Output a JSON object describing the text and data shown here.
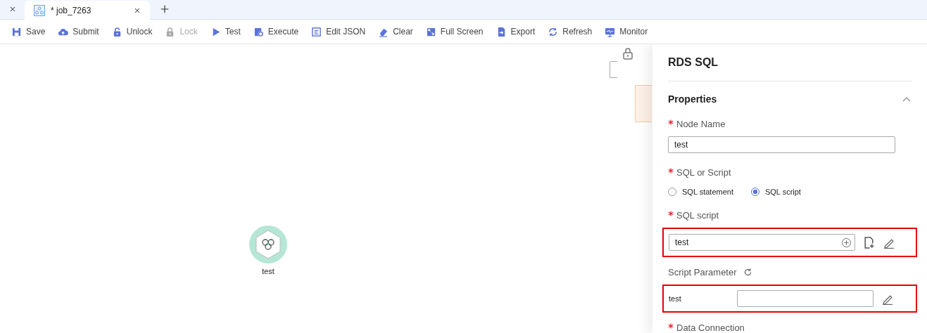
{
  "tabs": [
    {
      "label": "* job_7263",
      "selected": true
    }
  ],
  "toolbar": [
    {
      "kind": "save",
      "label": "Save",
      "disabled": false
    },
    {
      "kind": "submit",
      "label": "Submit",
      "disabled": false
    },
    {
      "kind": "unlock",
      "label": "Unlock",
      "disabled": false
    },
    {
      "kind": "lock",
      "label": "Lock",
      "disabled": true
    },
    {
      "kind": "test",
      "label": "Test",
      "disabled": false
    },
    {
      "kind": "execute",
      "label": "Execute",
      "disabled": false
    },
    {
      "kind": "json",
      "label": "Edit JSON",
      "disabled": false
    },
    {
      "kind": "clear",
      "label": "Clear",
      "disabled": false
    },
    {
      "kind": "fullscreen",
      "label": "Full Screen",
      "disabled": false
    },
    {
      "kind": "export",
      "label": "Export",
      "disabled": false
    },
    {
      "kind": "refresh",
      "label": "Refresh",
      "disabled": false
    },
    {
      "kind": "monitor",
      "label": "Monitor",
      "disabled": false
    }
  ],
  "canvas": {
    "nodes": [
      {
        "label": "test"
      }
    ]
  },
  "panel": {
    "title": "RDS SQL",
    "section": {
      "title": "Properties",
      "expanded": true
    },
    "fields": [
      {
        "kind": "text",
        "label": "Node Name",
        "required": true,
        "value": "test"
      },
      {
        "kind": "radio",
        "label": "SQL or Script",
        "required": true,
        "options": [
          {
            "label": "SQL statement",
            "selected": false
          },
          {
            "label": "SQL script",
            "selected": true
          }
        ]
      },
      {
        "kind": "script",
        "label": "SQL script",
        "required": true,
        "value": "test",
        "highlighted": true
      },
      {
        "kind": "params",
        "label": "Script Parameter",
        "required": false,
        "highlighted": true,
        "params": [
          {
            "name": "test"
          }
        ]
      },
      {
        "kind": "heading",
        "label": "Data Connection",
        "required": true
      }
    ]
  }
}
